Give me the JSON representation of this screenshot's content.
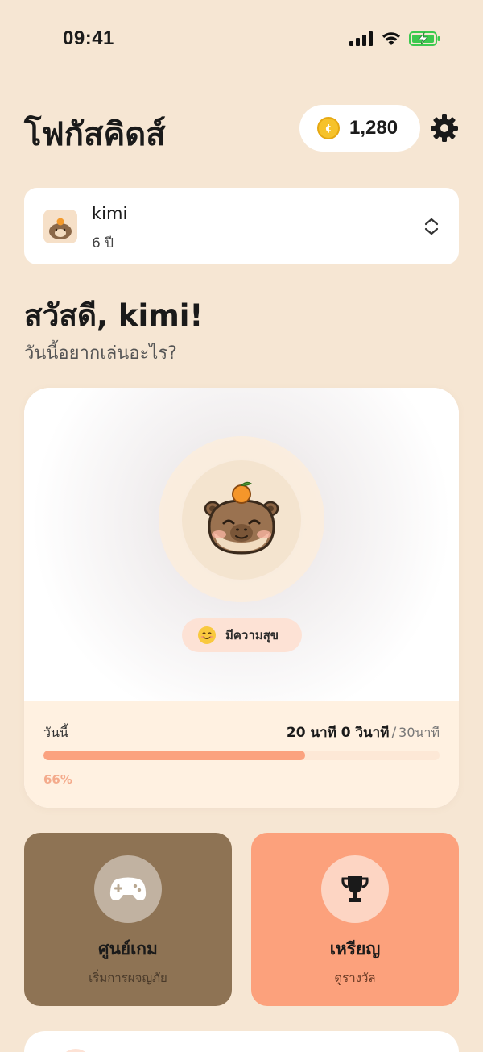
{
  "status_bar": {
    "time": "09:41"
  },
  "header": {
    "app_title": "โฟกัสคิดส์",
    "coins": "1,280",
    "coin_symbol": "¢"
  },
  "profile": {
    "name": "kimi",
    "age": "6 ปี"
  },
  "greeting": {
    "title": "สวัสดี, kimi!",
    "subtitle": "วันนี้อยากเล่นอะไร?"
  },
  "pet": {
    "mood_label": "มีความสุข",
    "today_label": "วันนี้",
    "time_played": "20 นาที 0 วินาที",
    "separator": "/",
    "time_goal": "30นาที",
    "progress_percent_label": "66%",
    "progress_fraction": 0.66
  },
  "tiles": [
    {
      "title": "ศูนย์เกม",
      "subtitle": "เริ่มการผจญภัย",
      "icon": "gamepad-icon"
    },
    {
      "title": "เหรียญ",
      "subtitle": "ดูรางวัล",
      "icon": "trophy-icon"
    }
  ],
  "colors": {
    "background": "#f6e6d3",
    "accent": "#fba27f",
    "games_tile": "#8e7354",
    "medals_tile": "#fca17c",
    "coin": "#f6c22a",
    "battery": "#3cc94e"
  }
}
